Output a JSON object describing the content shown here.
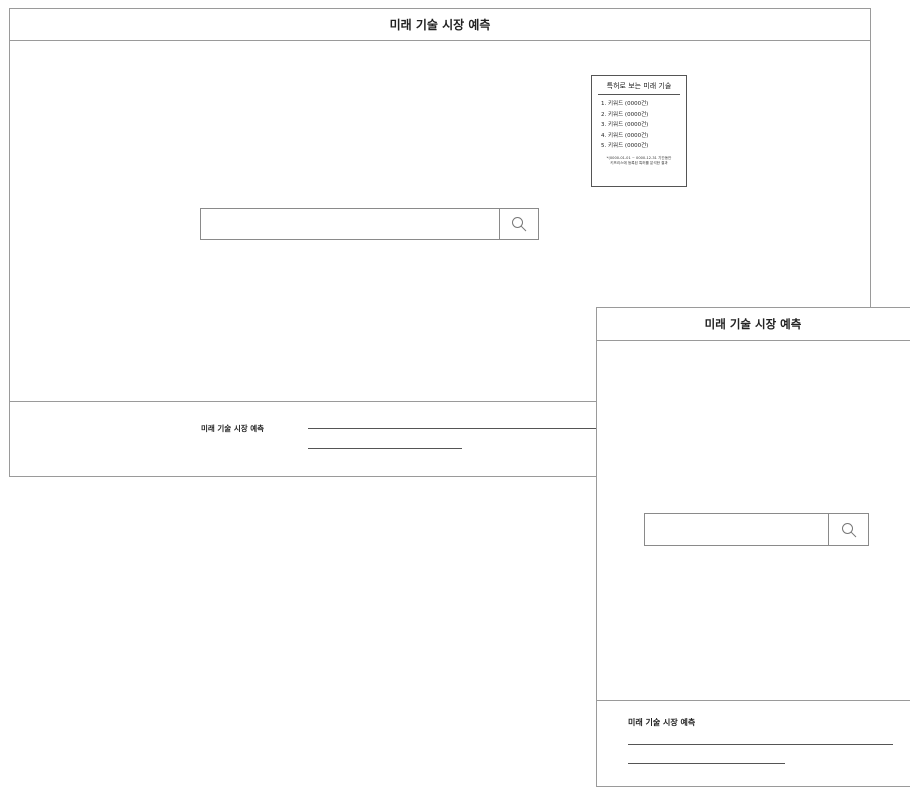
{
  "desktop": {
    "header": {
      "title": "미래 기술 시장 예측"
    },
    "search": {
      "value": "",
      "placeholder": ""
    },
    "patent_panel": {
      "title": "특허로 보는 미래 기술",
      "items": [
        {
          "label": "1.  키워드 (0000건)"
        },
        {
          "label": "2.  키워드 (0000건)"
        },
        {
          "label": "3.  키워드 (0000건)"
        },
        {
          "label": "4.  키워드 (0000건)"
        },
        {
          "label": "5.  키워드 (0000건)"
        }
      ],
      "note_line1": "*(0000-01-01 ~ 0000-12-31 기간동안",
      "note_line2": "키프리스에 등록된 특허를 분석한 결과"
    },
    "footer": {
      "title": "미래 기술 시장 예측"
    }
  },
  "mobile": {
    "header": {
      "title": "미래 기술 시장 예측"
    },
    "search": {
      "value": "",
      "placeholder": ""
    },
    "footer": {
      "title": "미래 기술 시장 예측"
    }
  },
  "icons": {
    "search": "search-icon"
  },
  "colors": {
    "border": "#9a9a9a",
    "text": "#222222",
    "line": "#555555"
  }
}
